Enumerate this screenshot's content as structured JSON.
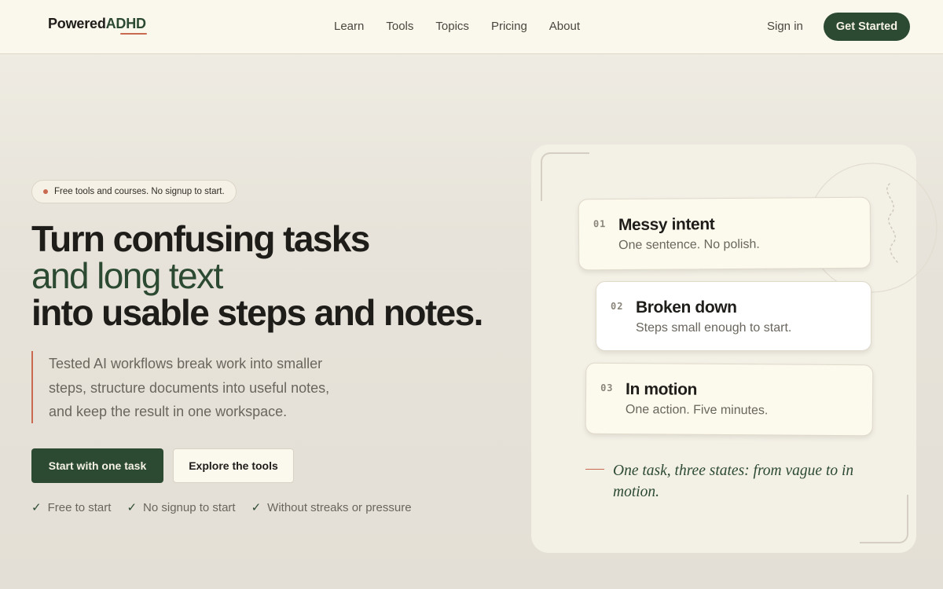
{
  "header": {
    "logo_part1": "Powered",
    "logo_part2": "ADHD",
    "nav": [
      "Learn",
      "Tools",
      "Topics",
      "Pricing",
      "About"
    ],
    "sign_in": "Sign in",
    "cta": "Get Started"
  },
  "hero": {
    "pill": "Free tools and courses. No signup to start.",
    "headline_line1": "Turn confusing tasks",
    "headline_line2": "and long text",
    "headline_line3": "into usable steps and notes.",
    "lead": "Tested AI workflows break work into smaller steps, structure documents into useful notes, and keep the result in one workspace.",
    "primary_button": "Start with one task",
    "secondary_button": "Explore the tools",
    "checks": [
      "Free to start",
      "No signup to start",
      "Without streaks or pressure"
    ],
    "check_mark": "✓"
  },
  "panel": {
    "cards": [
      {
        "number": "01",
        "title": "Messy intent",
        "subtitle": "One sentence. No polish."
      },
      {
        "number": "02",
        "title": "Broken down",
        "subtitle": "Steps small enough to start."
      },
      {
        "number": "03",
        "title": "In motion",
        "subtitle": "One action. Five minutes."
      }
    ],
    "caption": "One task, three states: from vague to in motion."
  },
  "colors": {
    "brand_green": "#2c4a32",
    "accent_terracotta": "#c9694f",
    "header_bg": "#faf7ec",
    "panel_bg": "#f3f0e6"
  }
}
